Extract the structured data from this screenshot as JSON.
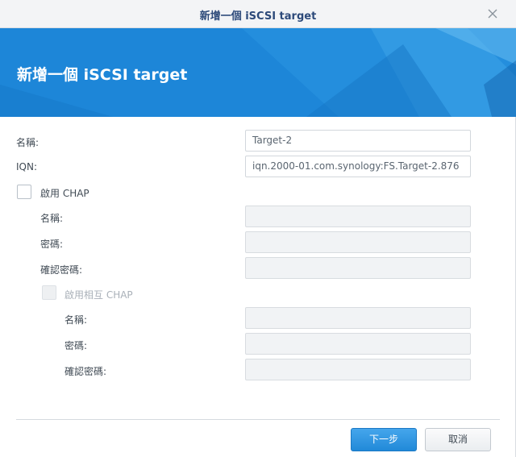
{
  "window": {
    "title": "新增一個 iSCSI target"
  },
  "banner": {
    "heading": "新增一個 iSCSI target",
    "color": "#1d86d8"
  },
  "form": {
    "name_label": "名稱:",
    "name_value": "Target-2",
    "iqn_label": "IQN:",
    "iqn_value": "iqn.2000-01.com.synology:FS.Target-2.876",
    "enable_chap_label": "啟用 CHAP",
    "enable_chap_checked": false,
    "chap": {
      "name_label": "名稱:",
      "password_label": "密碼:",
      "confirm_label": "確認密碼:"
    },
    "mutual_chap_label": "啟用相互 CHAP",
    "mutual_chap_checked": false,
    "mutual": {
      "name_label": "名稱:",
      "password_label": "密碼:",
      "confirm_label": "確認密碼:"
    }
  },
  "footer": {
    "next_label": "下一步",
    "cancel_label": "取消"
  },
  "icons": {
    "close": "close-icon"
  }
}
